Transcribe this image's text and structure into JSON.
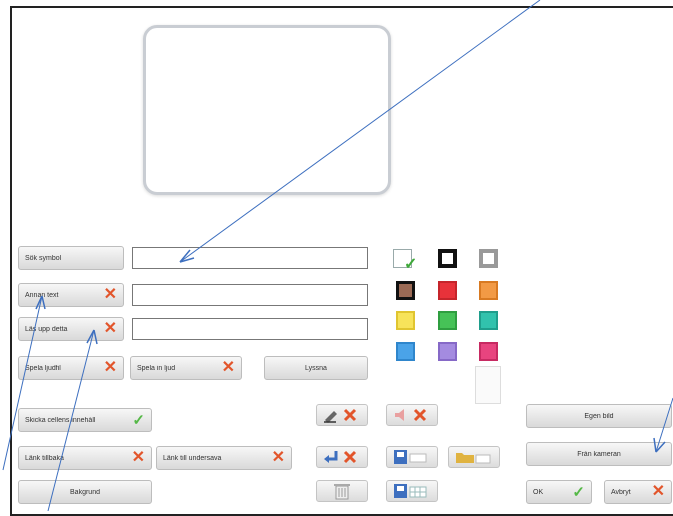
{
  "left_buttons": {
    "sok_symbol": "Sök symbol",
    "annan_text": "Annan text",
    "las_upp": "Läs upp detta",
    "spela_ljud": "Spela ljudfil",
    "spela_in": "Spela in ljud",
    "lyssna": "Lyssna"
  },
  "bottom_buttons": {
    "skicka": "Skicka cellens innehåll",
    "lank_tillbaka": "Länk tillbaka",
    "lank_under": "Länk till undersava",
    "bakgrund": "Bakgrund",
    "egen_bild": "Egen bild",
    "fran_kameran": "Från kameran",
    "ok": "OK",
    "avbryt": "Avbryt"
  },
  "colors": {
    "row1": [
      "#ffffff",
      "#111111",
      "#999999"
    ],
    "row2": [
      "#9b6a55",
      "#e8323a",
      "#f29a45"
    ],
    "row3": [
      "#f7e35a",
      "#46c257",
      "#31c2ad"
    ],
    "row4": [
      "#4aa3e8",
      "#a48be0",
      "#e8447f"
    ]
  },
  "accent": "#3d6fbf"
}
